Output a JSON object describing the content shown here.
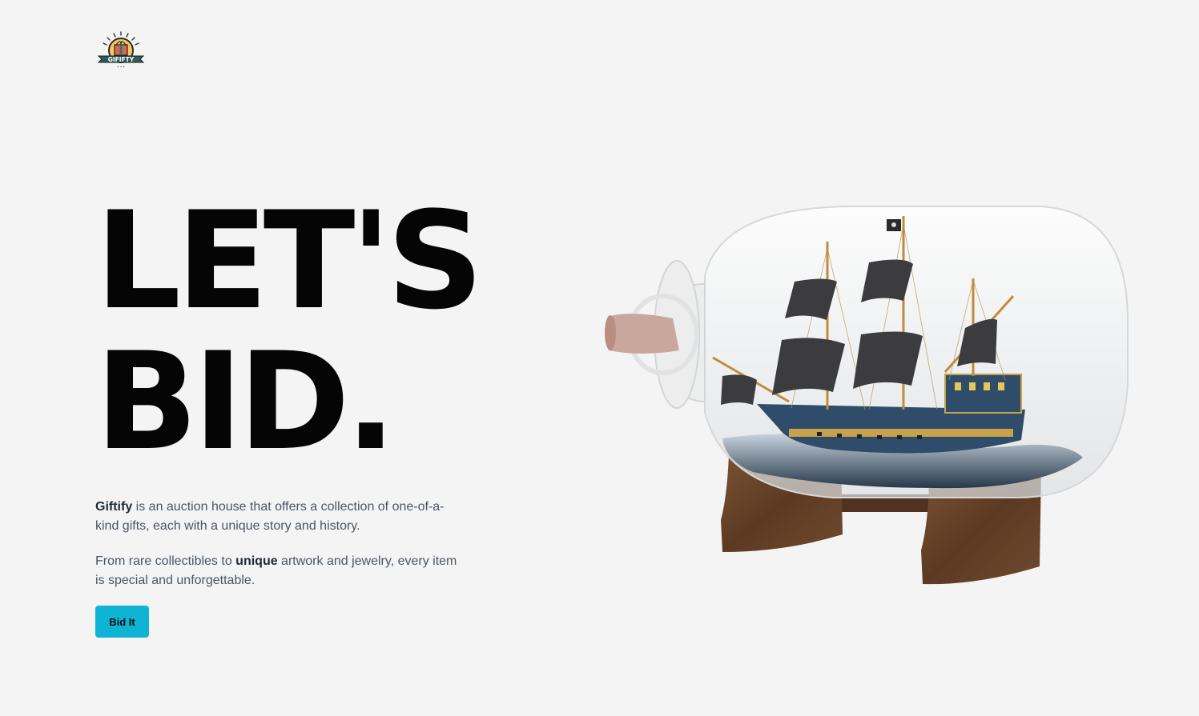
{
  "brand": {
    "logo_text": "GIFIFTY",
    "logo_subtext": "• • •"
  },
  "hero": {
    "title_line1": "LET'S",
    "title_line2": "BID."
  },
  "description": {
    "p1_strong": "Giftify",
    "p1_rest": " is an auction house that offers a collection of one-of-a-kind gifts, each with a unique story and history.",
    "p2_start": "From rare collectibles to ",
    "p2_strong": "unique",
    "p2_end": " artwork and jewelry, every item is special and unforgettable."
  },
  "cta": {
    "label": "Bid It"
  },
  "colors": {
    "background": "#f4f4f4",
    "accent": "#0fb3d4",
    "heading": "#050505",
    "body_text": "#4b5563"
  },
  "illustration": {
    "subject": "ship-in-a-bottle"
  }
}
